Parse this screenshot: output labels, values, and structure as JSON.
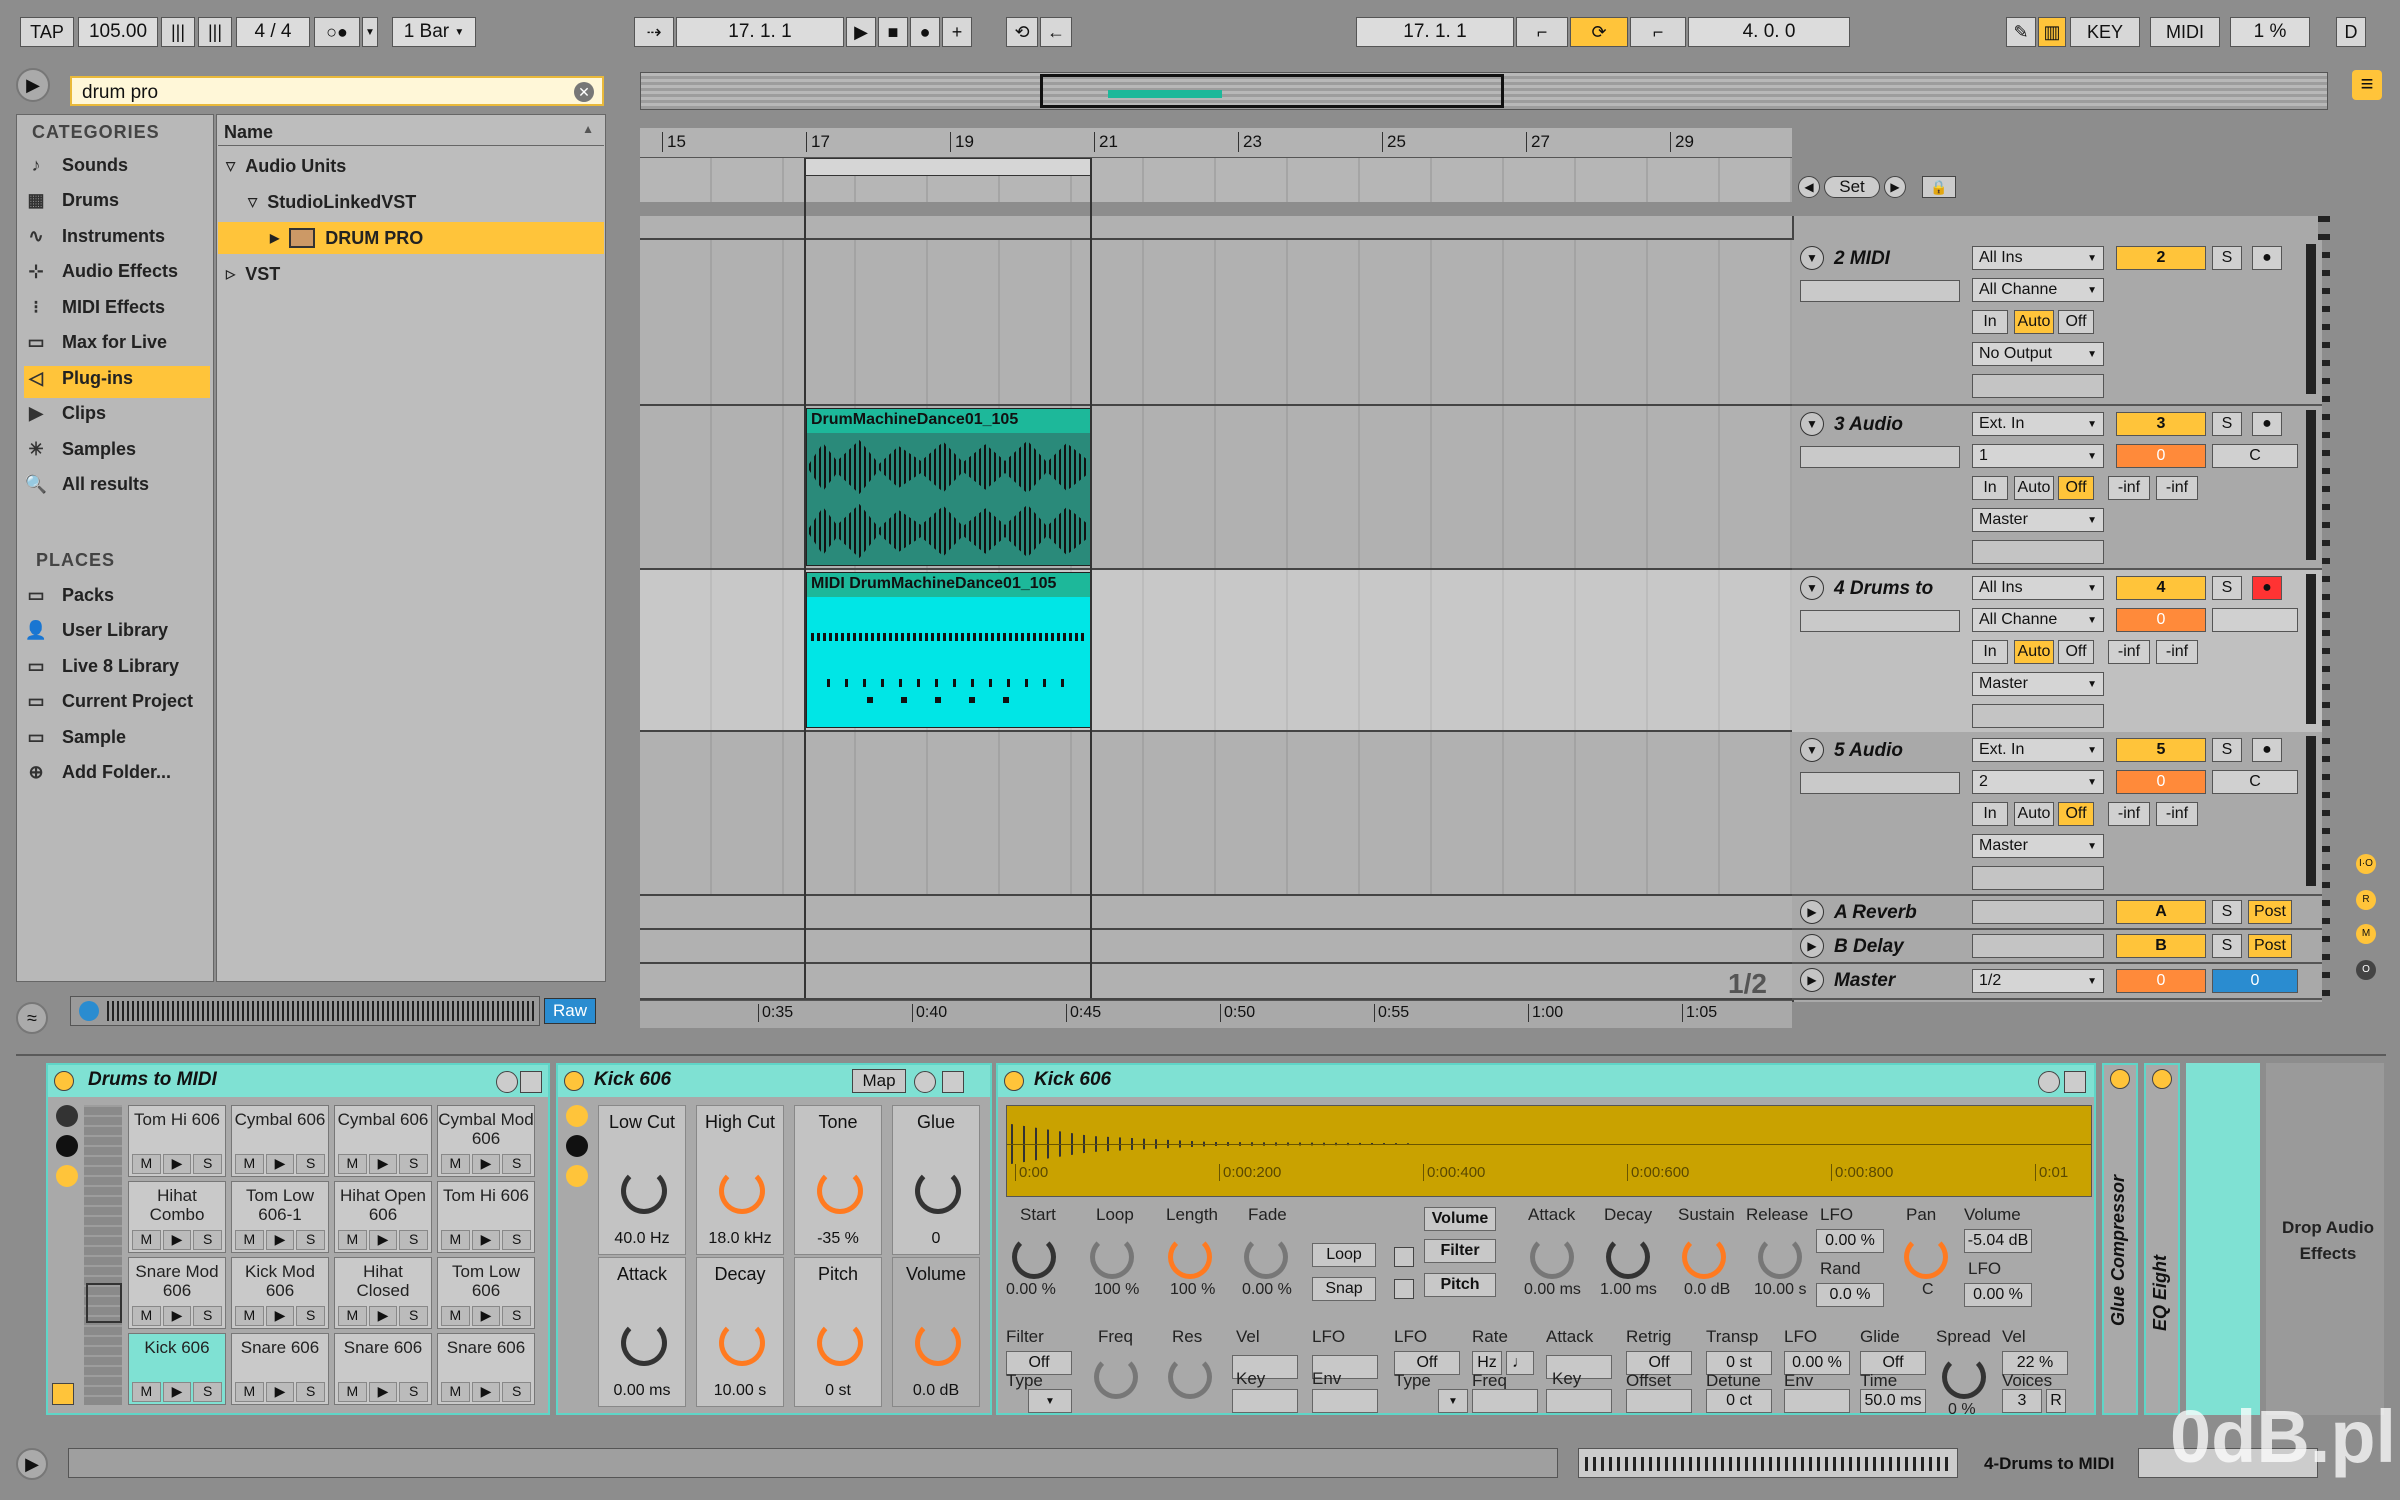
{
  "toolbar": {
    "tap": "TAP",
    "tempo": "105.00",
    "sig": "4 / 4",
    "quantize": "1 Bar",
    "arr_pos": "17.  1.  1",
    "loop_start": "17.  1.  1",
    "loop_len": "4.  0.  0",
    "key": "KEY",
    "midi": "MIDI",
    "cpu": "1 %",
    "d": "D"
  },
  "browser": {
    "search_value": "drum pro",
    "categories_header": "CATEGORIES",
    "places_header": "PLACES",
    "name_header": "Name",
    "categories": [
      {
        "label": "Sounds",
        "icon": "note-icon"
      },
      {
        "label": "Drums",
        "icon": "grid-icon"
      },
      {
        "label": "Instruments",
        "icon": "wave-icon"
      },
      {
        "label": "Audio Effects",
        "icon": "fx-icon"
      },
      {
        "label": "MIDI Effects",
        "icon": "midi-fx-icon"
      },
      {
        "label": "Max for Live",
        "icon": "max-icon"
      },
      {
        "label": "Plug-ins",
        "icon": "plug-icon"
      },
      {
        "label": "Clips",
        "icon": "clip-icon"
      },
      {
        "label": "Samples",
        "icon": "sample-icon"
      },
      {
        "label": "All results",
        "icon": "search-icon"
      }
    ],
    "places": [
      {
        "label": "Packs"
      },
      {
        "label": "User Library"
      },
      {
        "label": "Live 8 Library"
      },
      {
        "label": "Current Project"
      },
      {
        "label": "Sample"
      },
      {
        "label": "Add Folder..."
      }
    ],
    "tree": [
      {
        "label": "Audio Units"
      },
      {
        "label": "StudioLinkedVST"
      },
      {
        "label": "DRUM PRO"
      },
      {
        "label": "VST"
      }
    ],
    "raw": "Raw"
  },
  "arrangement": {
    "ruler": [
      "15",
      "17",
      "19",
      "21",
      "23",
      "25",
      "27",
      "29"
    ],
    "time_ruler": [
      "0:35",
      "0:40",
      "0:45",
      "0:50",
      "0:55",
      "1:00",
      "1:05"
    ],
    "set": "Set",
    "page": "1/2",
    "clips": [
      {
        "name": "DrumMachineDance01_105"
      },
      {
        "name": "MIDI DrumMachineDance01_105"
      }
    ]
  },
  "tracks": [
    {
      "name": "2 MIDI",
      "in1": "All Ins",
      "in2": "All Channe",
      "mon": [
        "In",
        "Auto",
        "Off"
      ],
      "out": "No Output",
      "num": "2",
      "s": "S"
    },
    {
      "name": "3 Audio",
      "in1": "Ext. In",
      "in2": "1",
      "mon": [
        "In",
        "Auto",
        "Off"
      ],
      "out": "Master",
      "num": "3",
      "vol": "0",
      "pan": "C",
      "s": "S",
      "inf1": "-inf",
      "inf2": "-inf"
    },
    {
      "name": "4 Drums to",
      "in1": "All Ins",
      "in2": "All Channe",
      "mon": [
        "In",
        "Auto",
        "Off"
      ],
      "out": "Master",
      "num": "4",
      "vol": "0",
      "s": "S",
      "inf1": "-inf",
      "inf2": "-inf"
    },
    {
      "name": "5 Audio",
      "in1": "Ext. In",
      "in2": "2",
      "mon": [
        "In",
        "Auto",
        "Off"
      ],
      "out": "Master",
      "num": "5",
      "vol": "0",
      "pan": "C",
      "s": "S",
      "inf1": "-inf",
      "inf2": "-inf"
    }
  ],
  "returns": [
    {
      "name": "A Reverb",
      "num": "A",
      "s": "S",
      "post": "Post"
    },
    {
      "name": "B Delay",
      "num": "B",
      "s": "S",
      "post": "Post"
    },
    {
      "name": "Master",
      "io": "1/2",
      "num": "0",
      "pan": "0"
    }
  ],
  "devices": {
    "rack": {
      "title": "Drums to MIDI",
      "pads": [
        [
          "Tom Hi 606",
          "Cymbal 606",
          "Cymbal 606",
          "Cymbal Mod 606"
        ],
        [
          "Hihat Combo",
          "Tom Low 606-1",
          "Hihat Open 606",
          "Tom Hi 606"
        ],
        [
          "Snare Mod 606",
          "Kick Mod 606",
          "Hihat Closed",
          "Tom Low 606"
        ],
        [
          "Kick 606",
          "Snare 606",
          "Snare 606",
          "Snare 606"
        ]
      ],
      "pad_ctrl": [
        "M",
        "▶",
        "S"
      ]
    },
    "kit": {
      "title": "Kick 606",
      "map": "Map",
      "knobs": [
        {
          "label": "Low Cut",
          "value": "40.0 Hz"
        },
        {
          "label": "High Cut",
          "value": "18.0 kHz"
        },
        {
          "label": "Tone",
          "value": "-35 %"
        },
        {
          "label": "Glue",
          "value": "0"
        },
        {
          "label": "Attack",
          "value": "0.00 ms"
        },
        {
          "label": "Decay",
          "value": "10.00 s"
        },
        {
          "label": "Pitch",
          "value": "0 st"
        },
        {
          "label": "Volume",
          "value": "0.0 dB"
        }
      ]
    },
    "simpler": {
      "title": "Kick 606",
      "times": [
        "0:00",
        "0:00:200",
        "0:00:400",
        "0:00:600",
        "0:00:800",
        "0:01"
      ],
      "labels": {
        "start": "Start",
        "loop": "Loop",
        "length": "Length",
        "fade": "Fade",
        "attack": "Attack",
        "decay": "Decay",
        "sustain": "Sustain",
        "release": "Release",
        "lfo": "LFO",
        "rand": "Rand",
        "pan": "Pan",
        "volume": "Volume",
        "filter": "Filter",
        "freq": "Freq",
        "res": "Res",
        "vel": "Vel",
        "key": "Key",
        "env": "Env",
        "type": "Type",
        "rate": "Rate",
        "retrig": "Retrig",
        "offset": "Offset",
        "transp": "Transp",
        "detune": "Detune",
        "glide": "Glide",
        "time": "Time",
        "spread": "Spread",
        "voices": "Voices"
      },
      "values": {
        "start": "0.00 %",
        "loop": "100 %",
        "length": "100 %",
        "fade": "0.00 %",
        "attack": "0.00 ms",
        "decay": "1.00 ms",
        "sustain": "0.0 dB",
        "release": "10.00 s",
        "lfo": "0.00 %",
        "rand": "0.0 %",
        "pan": "C",
        "volume": "-5.04 dB",
        "lfo2": "0.00 %",
        "filter": "Off",
        "lfo_type": "Off",
        "hz": "Hz",
        "note": "♩",
        "retrig": "Off",
        "transp": "0 st",
        "lfo3": "0.00 %",
        "glide": "Off",
        "detune": "0 ct",
        "time": "50.0 ms",
        "spread": "0 %",
        "vel": "22 %",
        "voices": "3",
        "r": "R"
      },
      "buttons": {
        "volume": "Volume",
        "filter": "Filter",
        "pitch": "Pitch",
        "loop": "Loop",
        "snap": "Snap"
      }
    },
    "glue": "Glue Compressor",
    "eq": "EQ Eight",
    "drop": "Drop Audio Effects"
  },
  "status": {
    "track": "4-Drums to MIDI",
    "watermark": "0dB.pl"
  },
  "colors": {
    "accent": "#ffc43a",
    "clip": "#00e6e6",
    "audio_clip": "#1db89a",
    "device": "#7fe1d3",
    "sample": "#c9a200"
  }
}
